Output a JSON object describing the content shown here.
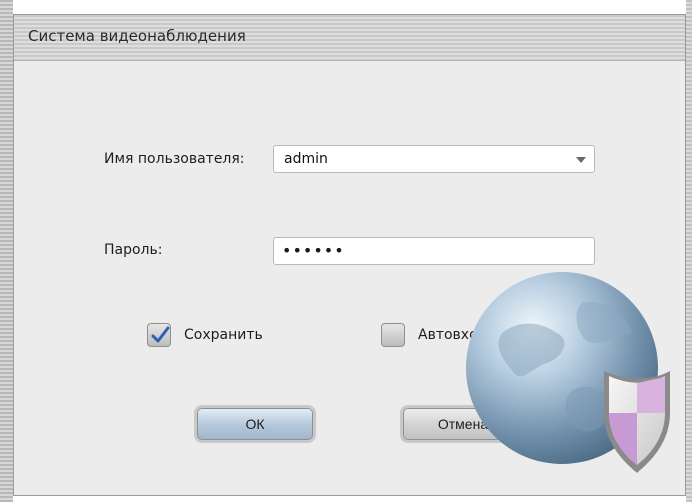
{
  "window": {
    "title": "Система видеонаблюдения"
  },
  "form": {
    "username_label": "Имя пользователя:",
    "username_value": "admin",
    "password_label": "Пароль:",
    "password_mask": "••••••",
    "save_label": "Сохранить",
    "save_checked": true,
    "autologin_label": "Автовход",
    "autologin_checked": false
  },
  "buttons": {
    "ok_label": "ОК",
    "cancel_label": "Отмена"
  },
  "icons": {
    "logo": "globe-shield-icon",
    "combo": "chevron-down-icon",
    "check": "checkmark-icon"
  },
  "colors": {
    "check_mark": "#2f5fb4",
    "ok_button": "#b7cadc",
    "shield_accent": "#c79ad3"
  }
}
